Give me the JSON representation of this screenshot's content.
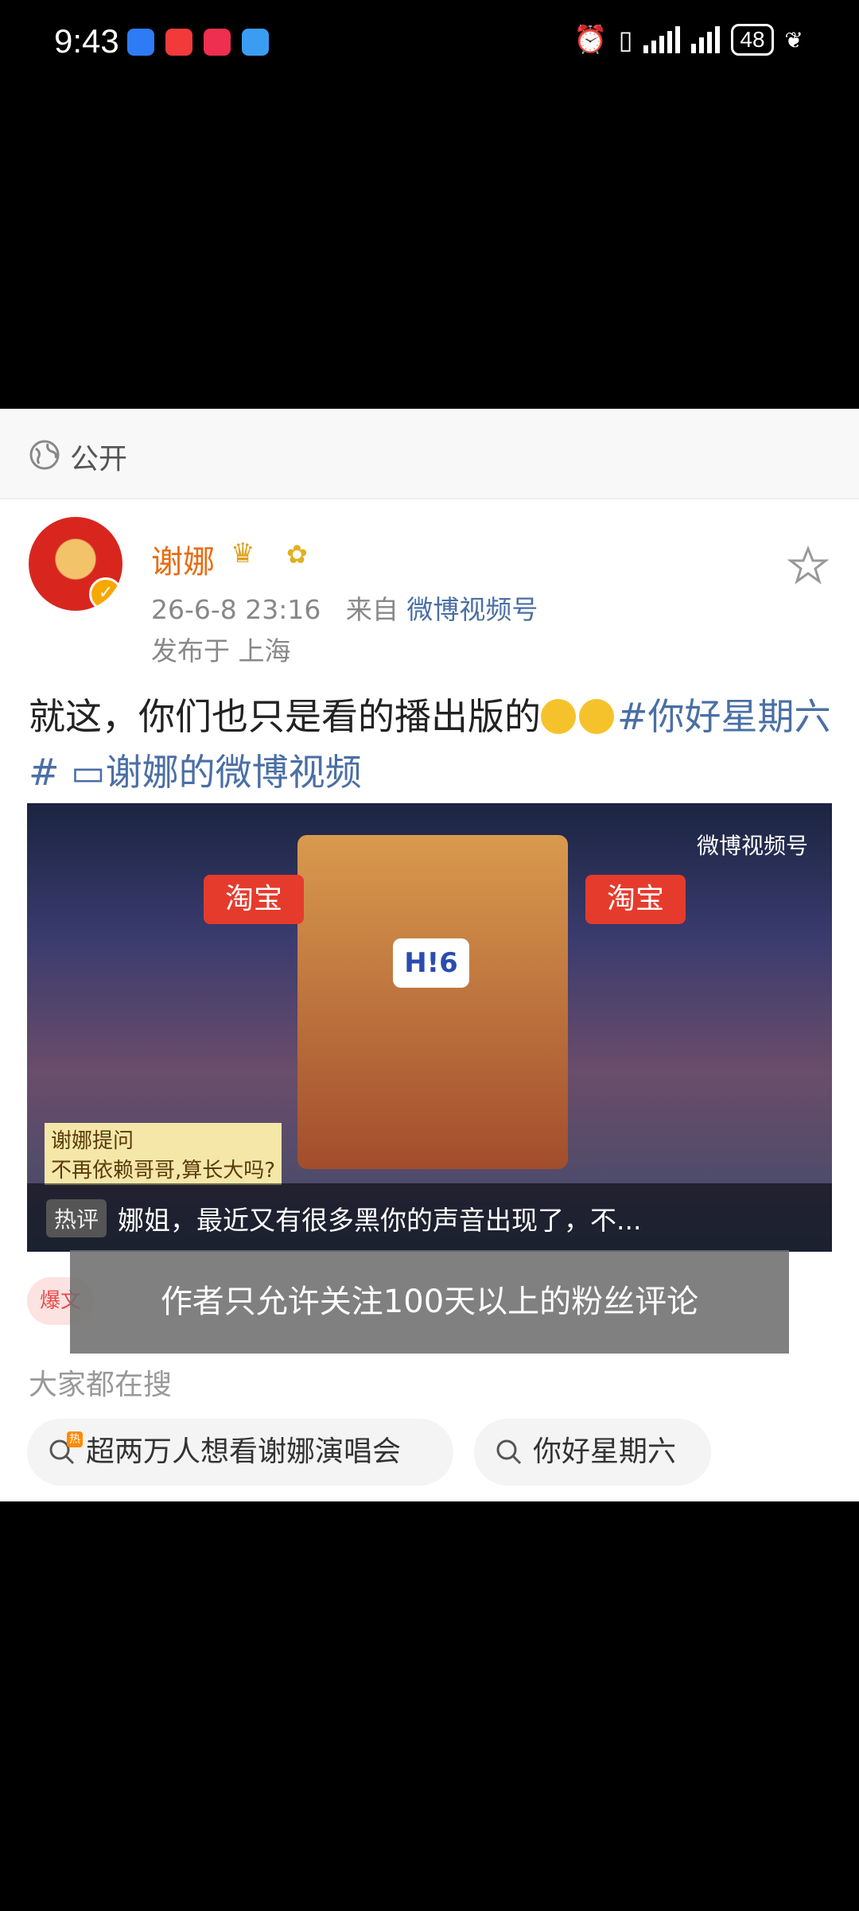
{
  "status_bar": {
    "time": "9:43",
    "battery": "48"
  },
  "visibility": {
    "label": "公开"
  },
  "post": {
    "username": "谢娜",
    "timestamp": "26-6-8 23:16",
    "source_prefix": "来自",
    "source": "微博视频号",
    "location": "发布于 上海",
    "text_main": "就这，你们也只是看的播出版的",
    "hashtag": "#你好星期六#",
    "video_link": "谢娜的微博视频"
  },
  "video": {
    "watermark": "微博视频号",
    "stage_logo": "H!6",
    "sponsor_left": "淘宝",
    "sponsor_right": "淘宝",
    "subtitle_name": "谢娜提问",
    "subtitle_text": "不再依赖哥哥,算长大吗?",
    "hot_comment_tag": "热评",
    "hot_comment": "娜姐，最近又有很多黑你的声音出现了，不..."
  },
  "reply_badge": "爆文",
  "toast": "作者只允许关注100天以上的粉丝评论",
  "search": {
    "title": "大家都在搜",
    "chips": [
      {
        "label": "超两万人想看谢娜演唱会",
        "hot": "热"
      },
      {
        "label": "你好星期六"
      }
    ]
  }
}
